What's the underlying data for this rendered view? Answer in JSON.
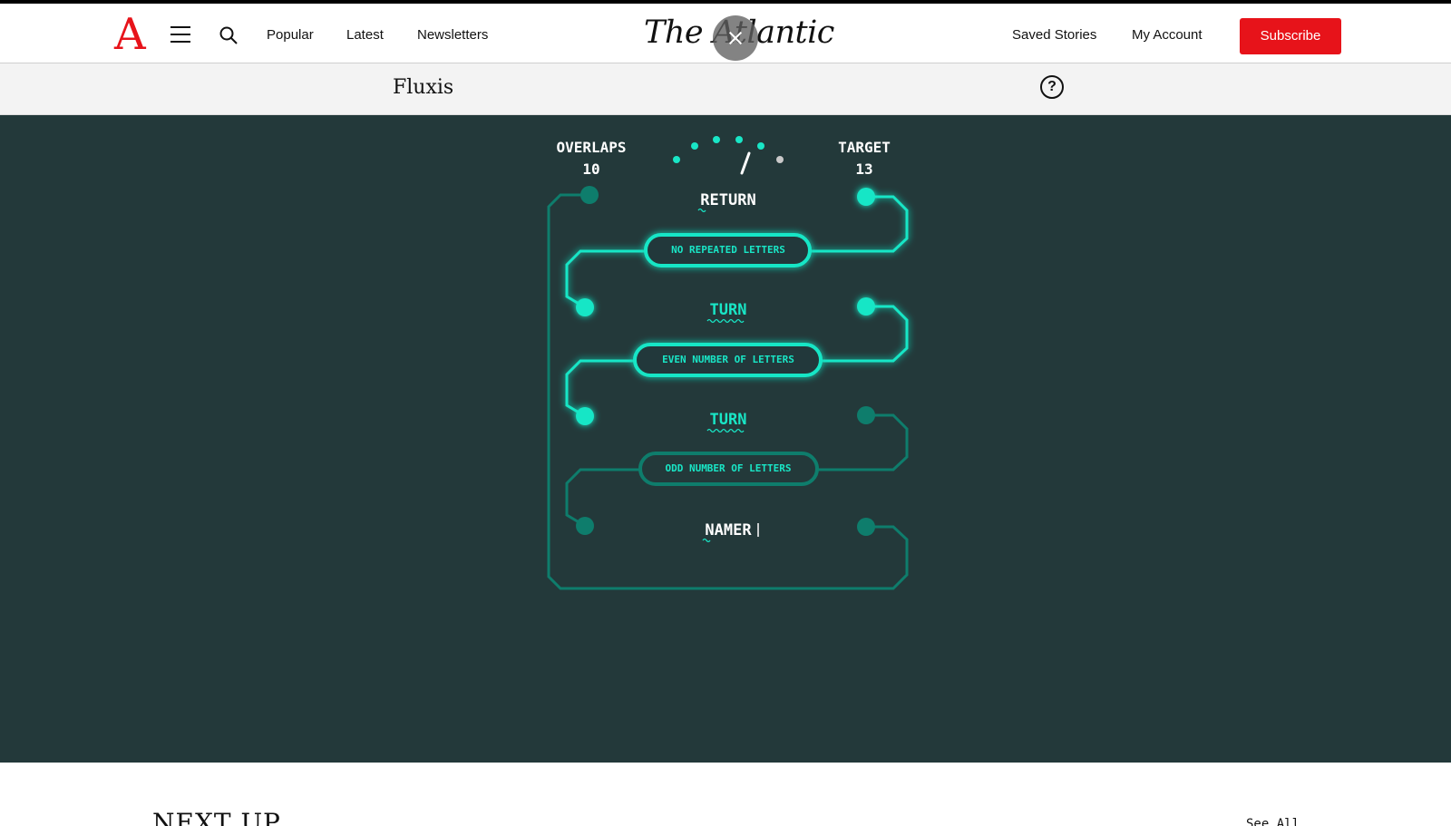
{
  "header": {
    "logo_letter": "A",
    "nav": [
      "Popular",
      "Latest",
      "Newsletters"
    ],
    "masthead": "The Atlantic",
    "saved_stories": "Saved Stories",
    "my_account": "My Account",
    "subscribe": "Subscribe"
  },
  "game": {
    "title": "Fluxis",
    "help_symbol": "?",
    "overlaps_label": "OVERLAPS",
    "overlaps_value": "10",
    "target_label": "TARGET",
    "target_value": "13",
    "gauge_dots_lit": 5,
    "gauge_dots_total": 6,
    "words": [
      "RETURN",
      "TURN",
      "TURN",
      "NAMER"
    ],
    "constraints": [
      "NO REPEATED LETTERS",
      "EVEN NUMBER OF LETTERS",
      "ODD NUMBER OF LETTERS"
    ],
    "colors": {
      "background": "#23393a",
      "active": "#19e6c6",
      "dim": "#0e7d6c",
      "text": "#ffffff"
    }
  },
  "footer": {
    "next_up": "NEXT UP",
    "see_all": "See All"
  }
}
